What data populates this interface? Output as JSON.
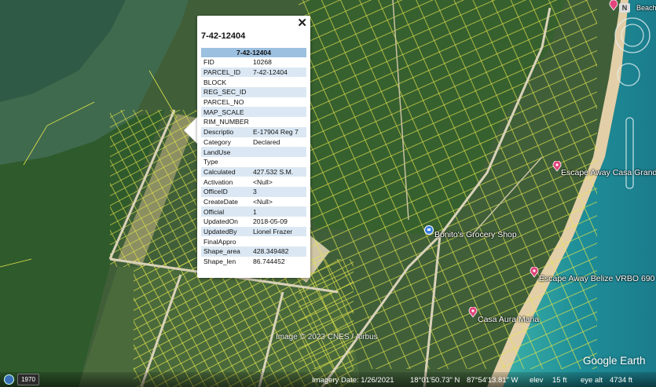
{
  "popup": {
    "title": "7-42-12404",
    "table_header": "7-42-12404",
    "rows": [
      {
        "key": "FID",
        "value": "10268"
      },
      {
        "key": "PARCEL_ID",
        "value": "7-42-12404"
      },
      {
        "key": "BLOCK",
        "value": ""
      },
      {
        "key": "REG_SEC_ID",
        "value": ""
      },
      {
        "key": "PARCEL_NO",
        "value": ""
      },
      {
        "key": "MAP_SCALE",
        "value": ""
      },
      {
        "key": "RIM_NUMBER",
        "value": ""
      },
      {
        "key": "Descriptio",
        "value": "E-17904 Reg 7"
      },
      {
        "key": "Category",
        "value": "Declared"
      },
      {
        "key": "LandUse",
        "value": ""
      },
      {
        "key": "Type",
        "value": ""
      },
      {
        "key": "Calculated",
        "value": "427.532 S.M."
      },
      {
        "key": "Activation",
        "value": "<Null>"
      },
      {
        "key": "OfficeID",
        "value": "3"
      },
      {
        "key": "CreateDate",
        "value": "<Null>"
      },
      {
        "key": "Official",
        "value": "1"
      },
      {
        "key": "UpdatedOn",
        "value": "2018-05-09"
      },
      {
        "key": "UpdatedBy",
        "value": "Lionel Frazer"
      },
      {
        "key": "FinalAppro",
        "value": ""
      },
      {
        "key": "Shape_area",
        "value": "428.349482"
      },
      {
        "key": "Shape_len",
        "value": "86.744452"
      }
    ],
    "close_icon": "close-icon"
  },
  "places": {
    "bonitos": "Bonito's Grocery Shop",
    "escape_casa": "Escape Away Casa Grande",
    "escape_belize": "Escape Away Belize VRBO 690",
    "casa_aura": "Casa Aura Maria",
    "beach": "Beach"
  },
  "watermark": "Image © 2023 CNES / Airbus",
  "logo": "Google Earth",
  "compass": "N",
  "status": {
    "year": "1970",
    "imagery_date": "Imagery Date: 1/26/2021",
    "lat": "18°01'50.73\" N",
    "lon": "87°54'13.81\" W",
    "elev_label": "elev",
    "elev": "15 ft",
    "eye_alt": "eye alt",
    "eye_alt_value": "4734 ft"
  },
  "colors": {
    "parcel_lines": "#e6e64a",
    "roads": "#d9d2b8",
    "sea": "#2e9fa0",
    "beach": "#e2cfa8",
    "pin": "#e0457b",
    "bonito_pin": "#3b7de0",
    "table_header": "#9cc0e0",
    "table_alt": "#dbe8f4"
  }
}
